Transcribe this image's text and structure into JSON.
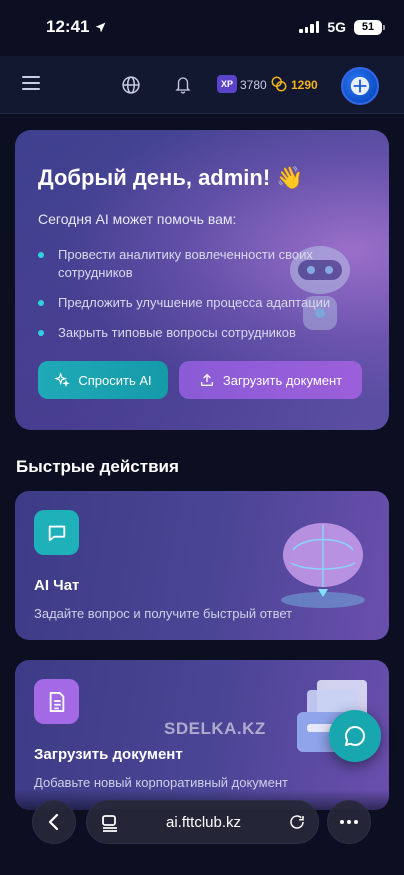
{
  "status_bar": {
    "time": "12:41",
    "network": "5G",
    "battery": "51"
  },
  "header": {
    "icons": [
      "menu-icon",
      "globe-icon",
      "bell-icon",
      "coin-icon"
    ],
    "xp_label": "XP",
    "xp_value": "3780",
    "coins_value": "1290"
  },
  "hero": {
    "title": "Добрый день, admin! 👋",
    "subtitle": "Сегодня AI может помочь вам:",
    "items": [
      "Провести аналитику вовлеченности своих сотрудников",
      "Предложить улучшение процесса адаптации",
      "Закрыть типовые вопросы сотрудников"
    ],
    "ask_button": "Спросить AI",
    "upload_button": "Загрузить документ"
  },
  "quick_actions": {
    "title": "Быстрые действия",
    "cards": [
      {
        "title": "AI Чат",
        "description": "Задайте вопрос и получите быстрый ответ",
        "icon": "chat-icon"
      },
      {
        "title": "Загрузить документ",
        "description": "Добавьте новый корпоративный документ",
        "icon": "document-icon"
      }
    ]
  },
  "watermark": "SDELKA.KZ",
  "browser": {
    "url": "ai.fttclub.kz"
  },
  "colors": {
    "background": "#0c0f22",
    "accent_teal": "#1fb1ba",
    "accent_purple": "#9c5fdb",
    "coin": "#f3b31c"
  }
}
